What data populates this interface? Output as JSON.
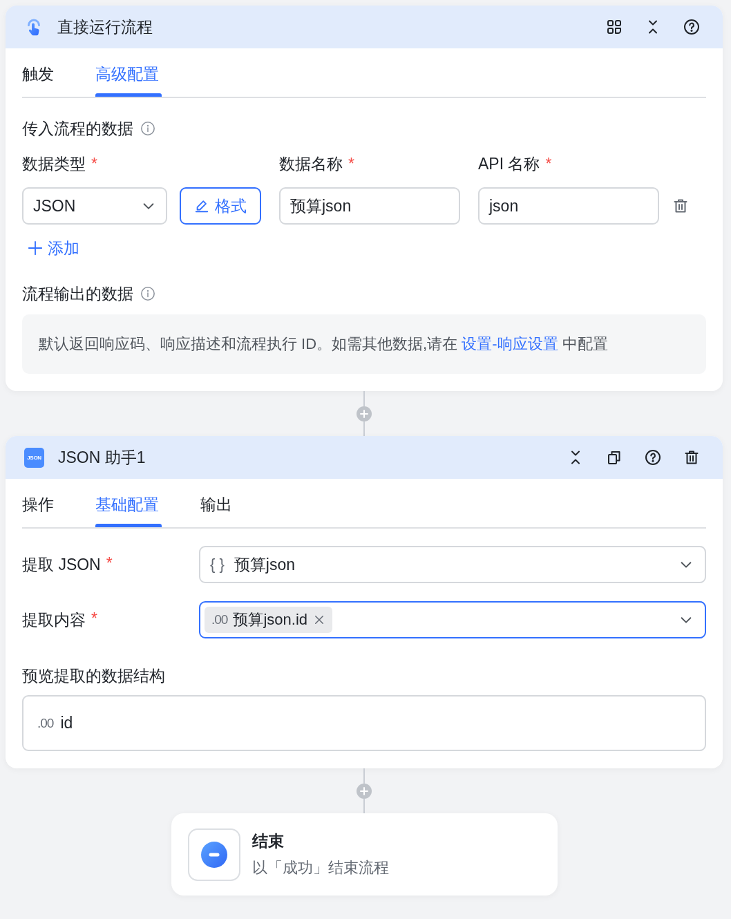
{
  "trigger_node": {
    "title": "直接运行流程",
    "tabs": [
      {
        "label": "触发",
        "selected": false
      },
      {
        "label": "高级配置",
        "selected": true
      }
    ],
    "input_data": {
      "title": "传入流程的数据",
      "columns": [
        {
          "label": "数据类型",
          "required_mark": "*"
        },
        {
          "label": "数据名称",
          "required_mark": "*"
        },
        {
          "label": "API 名称",
          "required_mark": "*"
        }
      ],
      "rows": [
        {
          "data_type": "JSON",
          "format_button": "格式",
          "data_name": "预算json",
          "api_name": "json"
        }
      ],
      "add_button": "添加"
    },
    "output_data": {
      "title": "流程输出的数据",
      "note": "默认返回响应码、响应描述和流程执行 ID。如需其他数据,请在 ",
      "link": "设置-响应设置",
      "note_end": " 中配置"
    }
  },
  "json_node": {
    "badge": "JSON",
    "title": "JSON 助手1",
    "tabs": [
      {
        "label": "操作",
        "selected": false
      },
      {
        "label": "基础配置",
        "selected": true
      },
      {
        "label": "输出",
        "selected": false
      }
    ],
    "fields": [
      {
        "kind": "select",
        "label": "提取 JSON",
        "required_mark": "*",
        "focused": false,
        "type_symbol": "{ }",
        "value": "预算json"
      },
      {
        "kind": "tags",
        "label": "提取内容",
        "required_mark": "*",
        "focused": true,
        "tags": [
          {
            "type_symbol": ".00",
            "label": "预算json.id"
          }
        ]
      }
    ],
    "preview": {
      "title": "预览提取的数据结构",
      "items": [
        {
          "type_symbol": ".00",
          "label": "id"
        }
      ]
    }
  },
  "end_node": {
    "title": "结束",
    "subtitle": "以「成功」结束流程"
  }
}
